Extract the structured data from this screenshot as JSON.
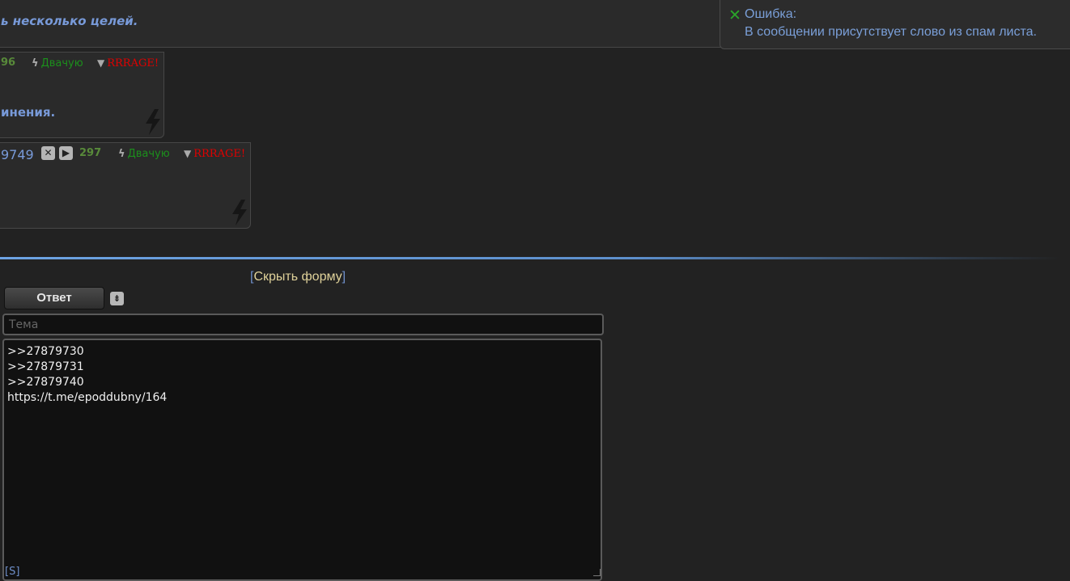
{
  "top_post": {
    "text": "ь несколько целей."
  },
  "post1": {
    "number_partial": "96",
    "like_label": "Двачую",
    "dislike_label": "RRRAGE!",
    "message_partial": "инения."
  },
  "post2": {
    "post_number_partial": "9749",
    "close_btn": "✕",
    "play_btn": "▶",
    "number": "297",
    "like_label": "Двачую",
    "dislike_label": "RRRAGE!"
  },
  "toast": {
    "title": "Ошибка:",
    "message": "В сообщении присутствует слово из спам листа."
  },
  "form": {
    "hide_open": "[",
    "hide_label": "Скрыть форму",
    "hide_close": "]",
    "reply_label": "Ответ",
    "subject_placeholder": "Тема",
    "body_lines": [
      ">>27879730",
      ">>27879731",
      ">>27879740",
      "https://t.me/epoddubny/164"
    ],
    "spoiler_tag": "[S]"
  },
  "colors": {
    "link_blue": "#789ad9",
    "like_green": "#1c8f1c",
    "rage_red": "#e00000",
    "hide_form_gold": "#e0d29a"
  }
}
